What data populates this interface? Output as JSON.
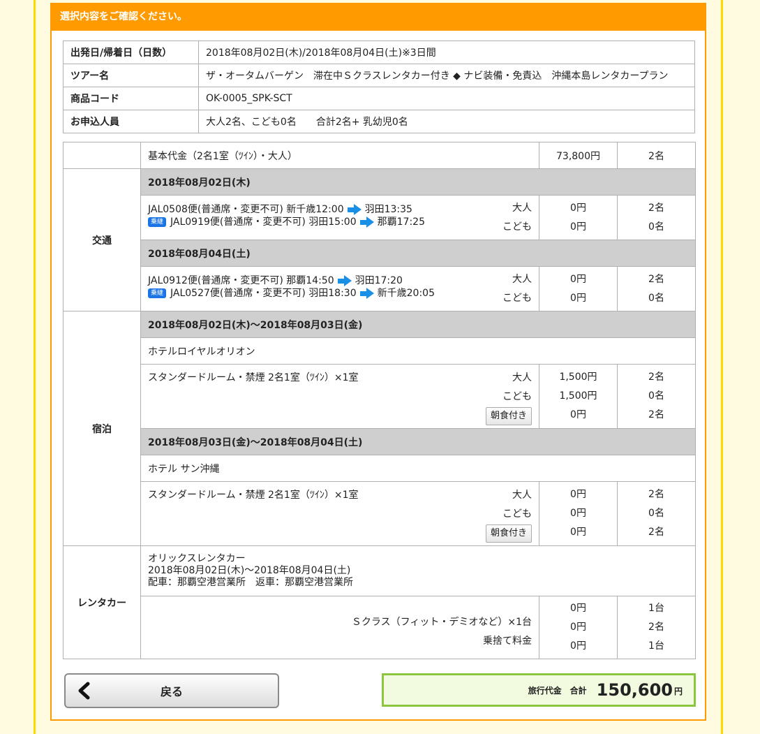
{
  "header": {
    "title": "選択内容をご確認ください。"
  },
  "summary": [
    {
      "label": "出発日/帰着日（日数）",
      "value": "2018年08月02日(木)/2018年08月04日(土)※3日間"
    },
    {
      "label": "ツアー名",
      "value": "ザ・オータムバーゲン　滞在中Ｓクラスレンタカー付き ◆ ナビ装備・免責込　沖縄本島レンタカープラン"
    },
    {
      "label": "商品コード",
      "value": "OK-0005_SPK-SCT"
    },
    {
      "label": "お申込人員",
      "value": "大人2名、こども0名　　合計2名+ 乳幼児0名"
    }
  ],
  "base": {
    "label": "基本代金（2名1室（ﾂｲﾝ）・大人）",
    "amount": "73,800円",
    "count": "2名"
  },
  "transport": {
    "section": "交通",
    "days": [
      {
        "date": "2018年08月02日(木)",
        "leg1": {
          "flight": "JAL0508便(普通席・変更不可) 新千歳12:00",
          "dest": "羽田13:35"
        },
        "leg2": {
          "badge": "乗継",
          "flight": "JAL0919便(普通席・変更不可) 羽田15:00",
          "dest": "那覇17:25"
        },
        "adult": "大人",
        "child": "こども",
        "adult_amt": "0円",
        "child_amt": "0円",
        "adult_cnt": "2名",
        "child_cnt": "0名"
      },
      {
        "date": "2018年08月04日(土)",
        "leg1": {
          "flight": "JAL0912便(普通席・変更不可) 那覇14:50",
          "dest": "羽田17:20"
        },
        "leg2": {
          "badge": "乗継",
          "flight": "JAL0527便(普通席・変更不可) 羽田18:30",
          "dest": "新千歳20:05"
        },
        "adult": "大人",
        "child": "こども",
        "adult_amt": "0円",
        "child_amt": "0円",
        "adult_cnt": "2名",
        "child_cnt": "0名"
      }
    ]
  },
  "hotel": {
    "section": "宿泊",
    "stays": [
      {
        "date": "2018年08月02日(木)〜2018年08月03日(金)",
        "name": "ホテルロイヤルオリオン",
        "room": "スタンダードルーム・禁煙 2名1室（ﾂｲﾝ）×1室",
        "adult": "大人",
        "child": "こども",
        "meal": "朝食付き",
        "amts": [
          "1,500円",
          "1,500円",
          "0円"
        ],
        "cnts": [
          "2名",
          "0名",
          "2名"
        ]
      },
      {
        "date": "2018年08月03日(金)〜2018年08月04日(土)",
        "name": "ホテル サン沖縄",
        "room": "スタンダードルーム・禁煙 2名1室（ﾂｲﾝ）×1室",
        "adult": "大人",
        "child": "こども",
        "meal": "朝食付き",
        "amts": [
          "0円",
          "0円",
          "0円"
        ],
        "cnts": [
          "2名",
          "0名",
          "2名"
        ]
      }
    ]
  },
  "rental": {
    "section": "レンタカー",
    "company": "オリックスレンタカー",
    "period": "2018年08月02日(木)〜2018年08月04日(土)",
    "pickup": "配車：那覇空港営業所　返車：那覇空港営業所",
    "car": "Ｓクラス（フィット・デミオなど）×1台",
    "dropoff": "乗捨て料金",
    "amts": [
      "0円",
      "0円",
      "0円"
    ],
    "cnts": [
      "1台",
      "2名",
      "1台"
    ]
  },
  "footer": {
    "back": "戻る",
    "total_label": "旅行代金　合計",
    "total": "150,600",
    "yen": "円"
  }
}
